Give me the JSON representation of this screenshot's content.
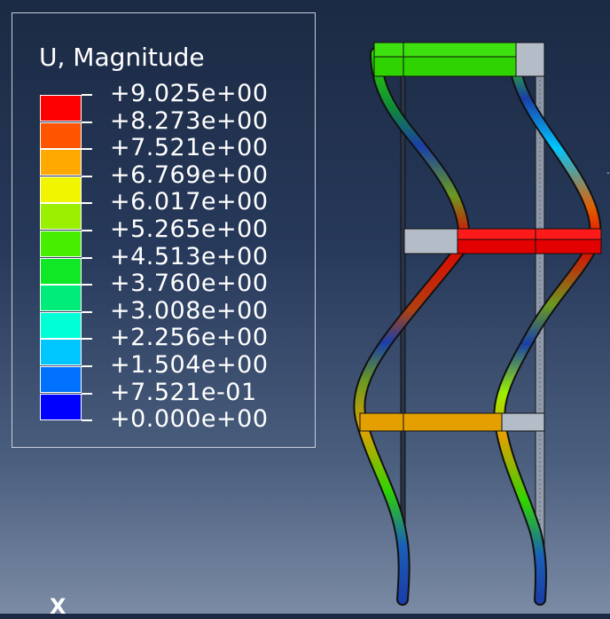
{
  "legend": {
    "title": "U, Magnitude",
    "levels": [
      {
        "label": "+9.025e+00",
        "color": "#ff0000"
      },
      {
        "label": "+8.273e+00",
        "color": "#ff5400"
      },
      {
        "label": "+7.521e+00",
        "color": "#ffa800"
      },
      {
        "label": "+6.769e+00",
        "color": "#f2f500"
      },
      {
        "label": "+6.017e+00",
        "color": "#9af000"
      },
      {
        "label": "+5.265e+00",
        "color": "#48ee00"
      },
      {
        "label": "+4.513e+00",
        "color": "#0fe825"
      },
      {
        "label": "+3.760e+00",
        "color": "#00ec7a"
      },
      {
        "label": "+3.008e+00",
        "color": "#00ffd5"
      },
      {
        "label": "+2.256e+00",
        "color": "#00c6ff"
      },
      {
        "label": "+1.504e+00",
        "color": "#0072ff"
      },
      {
        "label": "+7.521e-01",
        "color": "#0000ff"
      },
      {
        "label": "+0.000e+00"
      }
    ]
  },
  "triad": {
    "x_label": "X"
  },
  "model": {
    "undeformed_color": "#b4bcc8",
    "outline_color": "#111111",
    "floor_colors": {
      "top": "#2fd400",
      "middle": "#e30000",
      "bottom": "#e3a000"
    }
  }
}
